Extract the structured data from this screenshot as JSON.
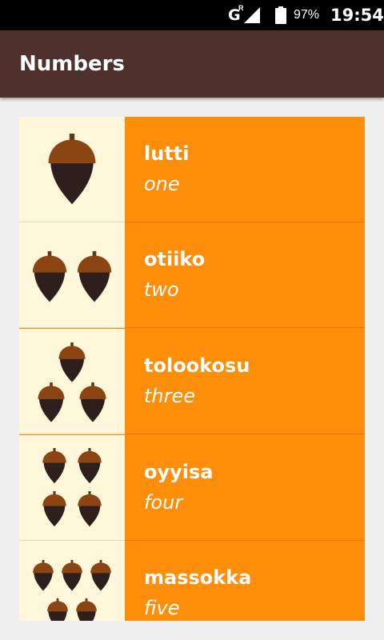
{
  "status_bar": {
    "network": "G",
    "network_sup": "R",
    "battery_percent": "97%",
    "time": "19:54",
    "icons": [
      "signal-icon",
      "battery-icon"
    ]
  },
  "app_bar": {
    "title": "Numbers",
    "color": "#4e312c"
  },
  "colors": {
    "item_background": "#fd8e09",
    "image_background": "#fff7da",
    "acorn_cap": "#8b4513",
    "acorn_body": "#2f1f1c"
  },
  "words": [
    {
      "word": "lutti",
      "meaning": "one",
      "acorn_count": 1
    },
    {
      "word": "otiiko",
      "meaning": "two",
      "acorn_count": 2
    },
    {
      "word": "tolookosu",
      "meaning": "three",
      "acorn_count": 3
    },
    {
      "word": "oyyisa",
      "meaning": "four",
      "acorn_count": 4
    },
    {
      "word": "massokka",
      "meaning": "five",
      "acorn_count": 5
    }
  ]
}
